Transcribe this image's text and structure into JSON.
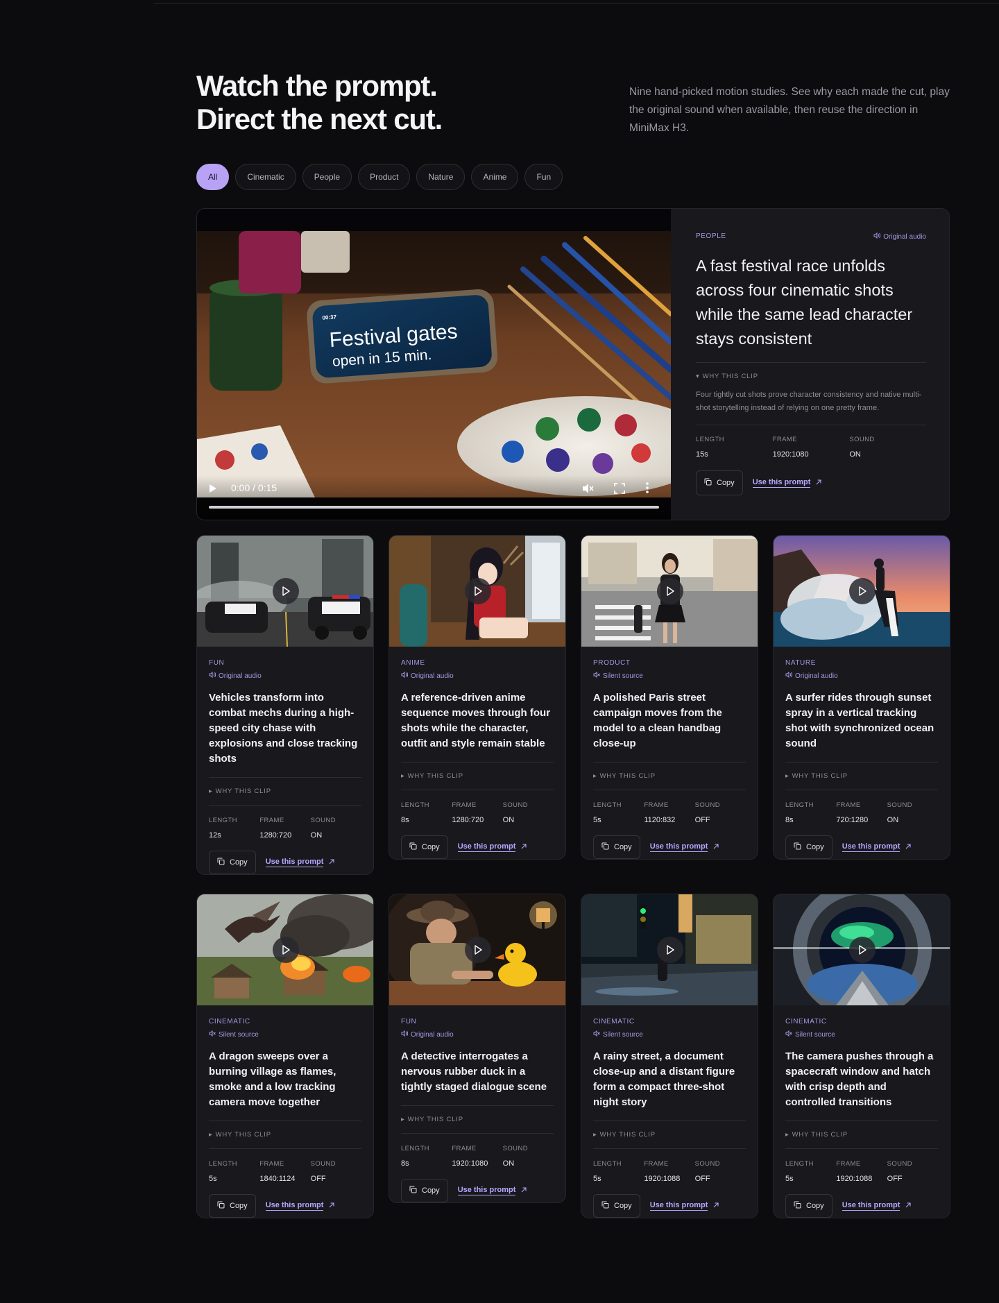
{
  "hero": {
    "title_line1": "Watch the prompt.",
    "title_line2": "Direct the next cut.",
    "description": "Nine hand-picked motion studies. See why each made the cut, play the original sound when available, then reuse the direction in MiniMax H3."
  },
  "filters": [
    "All",
    "Cinematic",
    "People",
    "Product",
    "Nature",
    "Anime",
    "Fun"
  ],
  "active_filter": "All",
  "featured": {
    "phone_time": "00:37",
    "phone_line1": "Festival gates",
    "phone_line2": "open in 15 min.",
    "time_display": "0:00 / 0:15",
    "category": "PEOPLE",
    "audio": "Original audio",
    "title": "A fast festival race unfolds across four cinematic shots while the same lead character stays consistent",
    "why_label": "WHY THIS CLIP",
    "why_text": "Four tightly cut shots prove character consistency and native multi-shot storytelling instead of relying on one pretty frame.",
    "stats": [
      {
        "label": "LENGTH",
        "value": "15s"
      },
      {
        "label": "FRAME",
        "value": "1920:1080"
      },
      {
        "label": "SOUND",
        "value": "ON"
      }
    ],
    "copy_label": "Copy",
    "use_label": "Use this prompt"
  },
  "labels": {
    "why": "WHY THIS CLIP",
    "length": "LENGTH",
    "frame": "FRAME",
    "sound": "SOUND",
    "copy": "Copy",
    "use": "Use this prompt"
  },
  "cards": [
    {
      "category": "FUN",
      "audio": "Original audio",
      "title": "Vehicles transform into combat mechs during a high-speed city chase with explosions and close tracking shots",
      "length": "12s",
      "frame": "1280:720",
      "sound": "ON"
    },
    {
      "category": "ANIME",
      "audio": "Original audio",
      "title": "A reference-driven anime sequence moves through four shots while the character, outfit and style remain stable",
      "length": "8s",
      "frame": "1280:720",
      "sound": "ON"
    },
    {
      "category": "PRODUCT",
      "audio": "Silent source",
      "title": "A polished Paris street campaign moves from the model to a clean handbag close-up",
      "length": "5s",
      "frame": "1120:832",
      "sound": "OFF"
    },
    {
      "category": "NATURE",
      "audio": "Original audio",
      "title": "A surfer rides through sunset spray in a vertical tracking shot with synchronized ocean sound",
      "length": "8s",
      "frame": "720:1280",
      "sound": "ON"
    },
    {
      "category": "CINEMATIC",
      "audio": "Silent source",
      "title": "A dragon sweeps over a burning village as flames, smoke and a low tracking camera move together",
      "length": "5s",
      "frame": "1840:1124",
      "sound": "OFF"
    },
    {
      "category": "FUN",
      "audio": "Original audio",
      "title": "A detective interrogates a nervous rubber duck in a tightly staged dialogue scene",
      "length": "8s",
      "frame": "1920:1080",
      "sound": "ON"
    },
    {
      "category": "CINEMATIC",
      "audio": "Silent source",
      "title": "A rainy street, a document close-up and a distant figure form a compact three-shot night story",
      "length": "5s",
      "frame": "1920:1088",
      "sound": "OFF"
    },
    {
      "category": "CINEMATIC",
      "audio": "Silent source",
      "title": "The camera pushes through a spacecraft window and hatch with crisp depth and controlled transitions",
      "length": "5s",
      "frame": "1920:1088",
      "sound": "OFF"
    }
  ]
}
